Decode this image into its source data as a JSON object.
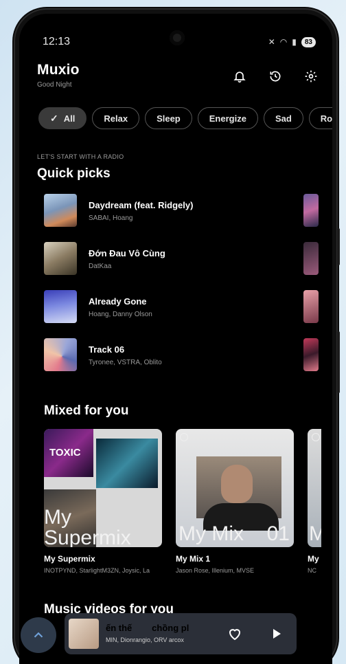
{
  "status_bar": {
    "time": "12:13",
    "battery": "83"
  },
  "header": {
    "title": "Muxio",
    "greeting": "Good Night"
  },
  "icons": {
    "notifications": "bell-icon",
    "history": "history-icon",
    "settings": "gear-icon"
  },
  "chips": [
    {
      "label": "All",
      "selected": true
    },
    {
      "label": "Relax",
      "selected": false
    },
    {
      "label": "Sleep",
      "selected": false
    },
    {
      "label": "Energize",
      "selected": false
    },
    {
      "label": "Sad",
      "selected": false
    },
    {
      "label": "Ro",
      "selected": false
    }
  ],
  "quick_picks": {
    "eyebrow": "LET'S START WITH A RADIO",
    "title": "Quick picks",
    "items": [
      {
        "title": "Daydream (feat. Ridgely)",
        "artist": "SABAI, Hoang"
      },
      {
        "title": "Đớn Đau Vô Cùng",
        "artist": "DatKaa"
      },
      {
        "title": "Already Gone",
        "artist": "Hoang, Danny Olson"
      },
      {
        "title": "Track 06",
        "artist": "Tyronee, VSTRA, Oblito"
      }
    ]
  },
  "mixed_for_you": {
    "title": "Mixed for you",
    "items": [
      {
        "name": "My Supermix",
        "artists": "INOTPYND, StarlightM3ZN, Joysic, La",
        "cover_text": "My Supermix",
        "cover_tag": "TOXIC"
      },
      {
        "name": "My Mix 1",
        "artists": "Jason Rose, Illenium, MVSE",
        "cover_text": "My Mix",
        "cover_number": "01"
      },
      {
        "name": "My",
        "artists": "NC",
        "cover_text": "M"
      }
    ]
  },
  "music_videos": {
    "title": "Music videos for you"
  },
  "mini_player": {
    "title": "ến thế        chồng pl",
    "artist": "MIN, Dionrangio, ORV arcox"
  },
  "colors": {
    "background": "#000000",
    "chip_active": "#3a3a3a",
    "player_bg": "#2b2f38"
  }
}
